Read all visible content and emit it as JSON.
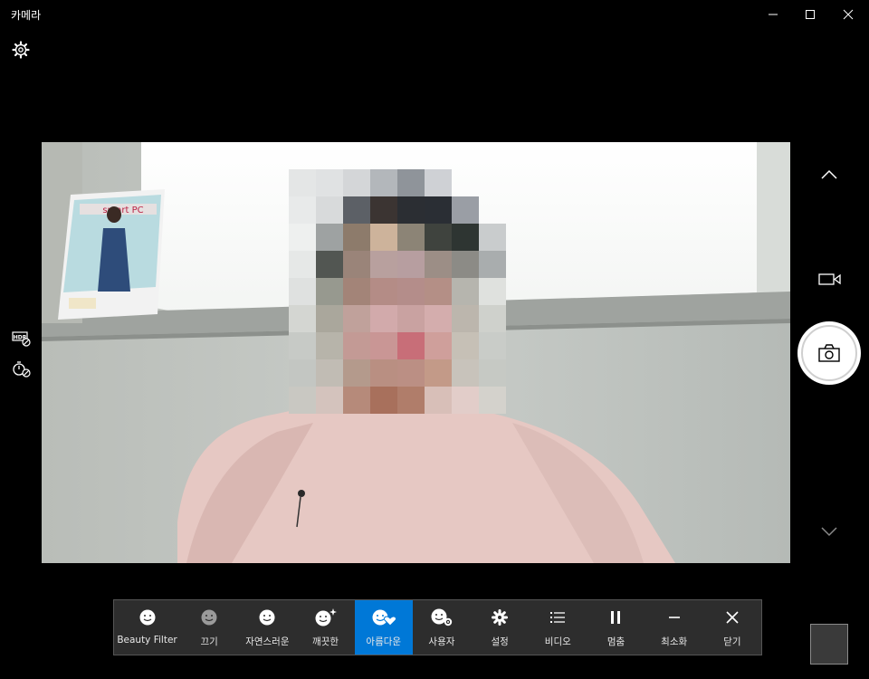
{
  "window": {
    "title": "카메라"
  },
  "filters": [
    {
      "label": "Beauty Filter",
      "icon": "smile-icon",
      "active": false
    },
    {
      "label": "끄기",
      "icon": "smile-muted-icon",
      "active": false
    },
    {
      "label": "자연스러운",
      "icon": "smile-icon",
      "active": false
    },
    {
      "label": "깨끗한",
      "icon": "smile-sparkle-icon",
      "active": false
    },
    {
      "label": "아름다운",
      "icon": "smile-heart-icon",
      "active": true
    },
    {
      "label": "사용자",
      "icon": "smile-gear-icon",
      "active": false
    },
    {
      "label": "설정",
      "icon": "gear-icon",
      "active": false
    },
    {
      "label": "비디오",
      "icon": "list-icon",
      "active": false
    },
    {
      "label": "멈춤",
      "icon": "pause-icon",
      "active": false
    },
    {
      "label": "최소화",
      "icon": "minimize-icon",
      "active": false
    },
    {
      "label": "닫기",
      "icon": "close-icon",
      "active": false
    }
  ],
  "colors": {
    "accent": "#0078d7",
    "bar": "#2d2d2d"
  }
}
